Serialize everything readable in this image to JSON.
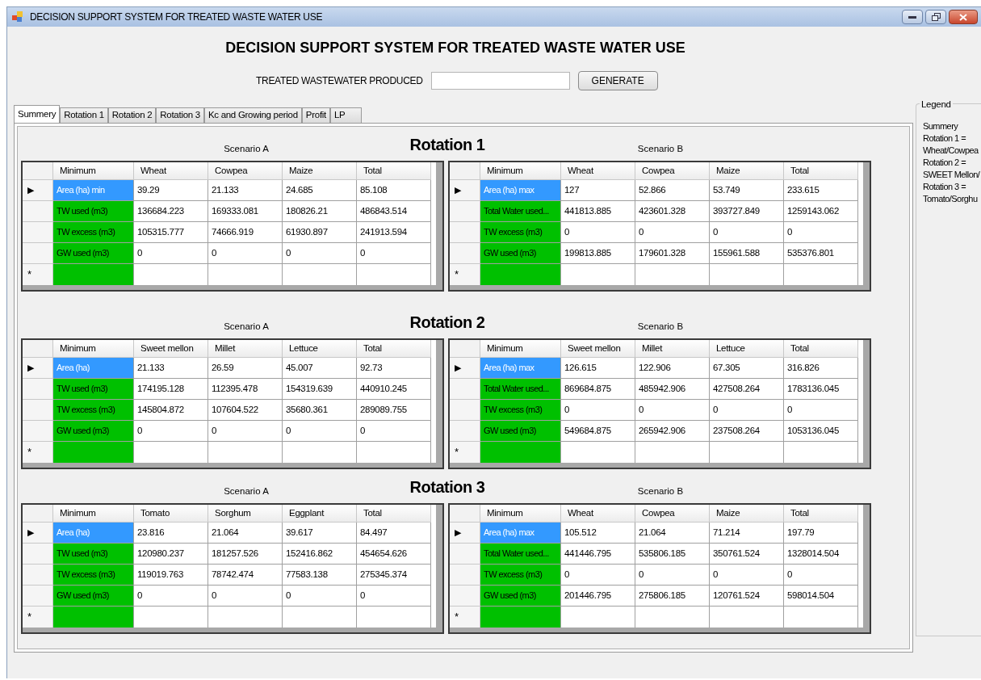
{
  "window": {
    "title": "DECISION SUPPORT SYSTEM FOR TREATED WASTE WATER USE"
  },
  "heading": "DECISION SUPPORT SYSTEM FOR TREATED WASTE WATER USE",
  "input": {
    "label": "TREATED WASTEWATER PRODUCED",
    "button": "GENERATE"
  },
  "tabs": [
    {
      "label": "Summery",
      "selected": true
    },
    {
      "label": "Rotation 1",
      "selected": false
    },
    {
      "label": "Rotation 2",
      "selected": false
    },
    {
      "label": "Rotation 3",
      "selected": false
    },
    {
      "label": "Kc and Growing period",
      "selected": false
    },
    {
      "label": "Profit",
      "selected": false
    },
    {
      "label": "LP",
      "selected": false
    }
  ],
  "rotations": [
    {
      "title": "Rotation 1",
      "scenarios": [
        {
          "label": "Scenario A",
          "columns": [
            "Minimum",
            "Wheat",
            "Cowpea",
            "Maize",
            "Total"
          ],
          "rows": [
            {
              "marker": "▶",
              "selected": true,
              "cells": [
                "Area (ha) min",
                "39.29",
                "21.133",
                "24.685",
                "85.108"
              ]
            },
            {
              "selected": false,
              "cells": [
                "TW used (m3)",
                "136684.223",
                "169333.081",
                "180826.21",
                "486843.514"
              ]
            },
            {
              "selected": false,
              "cells": [
                "TW excess (m3)",
                "105315.777",
                "74666.919",
                "61930.897",
                "241913.594"
              ]
            },
            {
              "selected": false,
              "cells": [
                "GW used (m3)",
                "0",
                "0",
                "0",
                "0"
              ]
            }
          ],
          "new_row_marker": "*"
        },
        {
          "label": "Scenario B",
          "columns": [
            "Minimum",
            "Wheat",
            "Cowpea",
            "Maize",
            "Total"
          ],
          "rows": [
            {
              "marker": "▶",
              "selected": true,
              "cells": [
                "Area (ha) max",
                "127",
                "52.866",
                "53.749",
                "233.615"
              ]
            },
            {
              "selected": false,
              "cells": [
                "Total Water used...",
                "441813.885",
                "423601.328",
                "393727.849",
                "1259143.062"
              ]
            },
            {
              "selected": false,
              "cells": [
                "TW excess (m3)",
                "0",
                "0",
                "0",
                "0"
              ]
            },
            {
              "selected": false,
              "cells": [
                "GW used (m3)",
                "199813.885",
                "179601.328",
                "155961.588",
                "535376.801"
              ]
            }
          ],
          "new_row_marker": "*"
        }
      ]
    },
    {
      "title": "Rotation 2",
      "scenarios": [
        {
          "label": "Scenario A",
          "columns": [
            "Minimum",
            "Sweet mellon",
            "Millet",
            "Lettuce",
            "Total"
          ],
          "rows": [
            {
              "marker": "▶",
              "selected": true,
              "cells": [
                "Area (ha)",
                "21.133",
                "26.59",
                "45.007",
                "92.73"
              ]
            },
            {
              "selected": false,
              "cells": [
                "TW used (m3)",
                "174195.128",
                "112395.478",
                "154319.639",
                "440910.245"
              ]
            },
            {
              "selected": false,
              "cells": [
                "TW excess (m3)",
                "145804.872",
                "107604.522",
                "35680.361",
                "289089.755"
              ]
            },
            {
              "selected": false,
              "cells": [
                "GW used (m3)",
                "0",
                "0",
                "0",
                "0"
              ]
            }
          ],
          "new_row_marker": "*"
        },
        {
          "label": "Scenario B",
          "columns": [
            "Minimum",
            "Sweet mellon",
            "Millet",
            "Lettuce",
            "Total"
          ],
          "rows": [
            {
              "marker": "▶",
              "selected": true,
              "cells": [
                "Area (ha) max",
                "126.615",
                "122.906",
                "67.305",
                "316.826"
              ]
            },
            {
              "selected": false,
              "cells": [
                "Total Water used...",
                "869684.875",
                "485942.906",
                "427508.264",
                "1783136.045"
              ]
            },
            {
              "selected": false,
              "cells": [
                "TW excess (m3)",
                "0",
                "0",
                "0",
                "0"
              ]
            },
            {
              "selected": false,
              "cells": [
                "GW used (m3)",
                "549684.875",
                "265942.906",
                "237508.264",
                "1053136.045"
              ]
            }
          ],
          "new_row_marker": "*"
        }
      ]
    },
    {
      "title": "Rotation 3",
      "scenarios": [
        {
          "label": "Scenario A",
          "columns": [
            "Minimum",
            "Tomato",
            "Sorghum",
            "Eggplant",
            "Total"
          ],
          "rows": [
            {
              "marker": "▶",
              "selected": true,
              "cells": [
                "Area (ha)",
                "23.816",
                "21.064",
                "39.617",
                "84.497"
              ]
            },
            {
              "selected": false,
              "cells": [
                "TW used (m3)",
                "120980.237",
                "181257.526",
                "152416.862",
                "454654.626"
              ]
            },
            {
              "selected": false,
              "cells": [
                "TW excess (m3)",
                "119019.763",
                "78742.474",
                "77583.138",
                "275345.374"
              ]
            },
            {
              "selected": false,
              "cells": [
                "GW used (m3)",
                "0",
                "0",
                "0",
                "0"
              ]
            }
          ],
          "new_row_marker": "*"
        },
        {
          "label": "Scenario B",
          "columns": [
            "Minimum",
            "Wheat",
            "Cowpea",
            "Maize",
            "Total"
          ],
          "rows": [
            {
              "marker": "▶",
              "selected": true,
              "cells": [
                "Area (ha) max",
                "105.512",
                "21.064",
                "71.214",
                "197.79"
              ]
            },
            {
              "selected": false,
              "cells": [
                "Total Water used...",
                "441446.795",
                "535806.185",
                "350761.524",
                "1328014.504"
              ]
            },
            {
              "selected": false,
              "cells": [
                "TW excess (m3)",
                "0",
                "0",
                "0",
                "0"
              ]
            },
            {
              "selected": false,
              "cells": [
                "GW used (m3)",
                "201446.795",
                "275806.185",
                "120761.524",
                "598014.504"
              ]
            }
          ],
          "new_row_marker": "*"
        }
      ]
    }
  ],
  "legend": {
    "title": "Legend",
    "lines": [
      "Summery",
      "Rotation 1 =",
      "Wheat/Cowpea",
      "Rotation 2 =",
      "SWEET Mellon/",
      "Rotation 3 =",
      "Tomato/Sorghu"
    ]
  }
}
